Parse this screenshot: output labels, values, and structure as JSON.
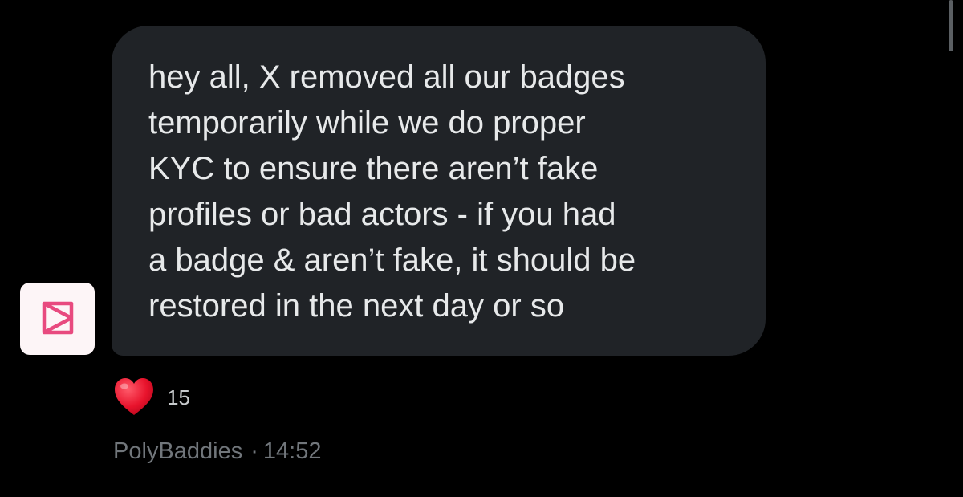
{
  "message": {
    "text": "hey all, X removed all our badges\ntemporarily while we do proper\nKYC to ensure there aren’t fake\nprofiles or bad actors - if you had\na badge & aren’t fake, it should be\nrestored in the next day or so"
  },
  "reaction": {
    "icon": "heart-icon",
    "count": "15",
    "color": "#e8132c"
  },
  "meta": {
    "sender": "PolyBaddies",
    "separator": "·",
    "time": "14:52"
  },
  "avatar": {
    "icon": "polybaddies-logo-icon",
    "logo_color": "#e84a7f"
  },
  "colors": {
    "background": "#000000",
    "bubble": "#202327",
    "text": "#e7e9ea",
    "meta_text": "#71767b"
  }
}
